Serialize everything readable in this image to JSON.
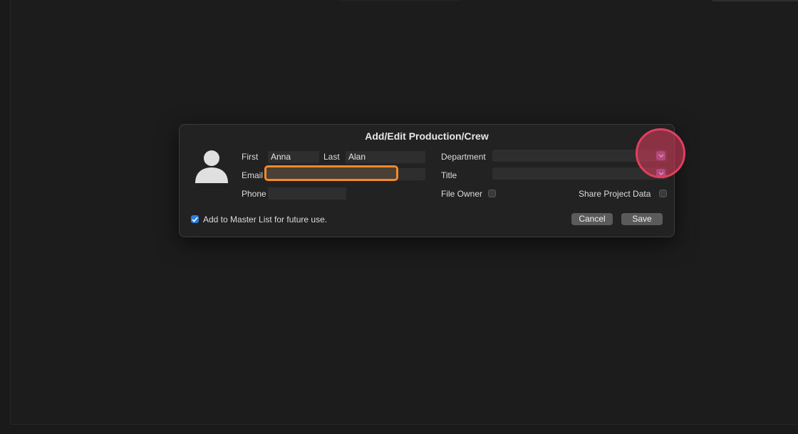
{
  "dialog": {
    "title": "Add/Edit Production/Crew",
    "fields": {
      "first_label": "First",
      "first_value": "Anna",
      "last_label": "Last",
      "last_value": "Alan",
      "email_label": "Email",
      "email_value": "",
      "phone_label": "Phone",
      "phone_value": ""
    },
    "right": {
      "department_label": "Department",
      "department_value": "",
      "title_label": "Title",
      "title_value": "",
      "file_owner_label": "File Owner",
      "share_label": "Share Project Data"
    },
    "master_list_label": "Add to Master List for future use.",
    "master_list_checked": true,
    "cancel_label": "Cancel",
    "save_label": "Save"
  },
  "colors": {
    "highlight": "#f38a2a",
    "click_indicator": "#e0405e",
    "dropdown_accent": "#7e56a8",
    "checkbox_accent": "#2b7de0"
  }
}
